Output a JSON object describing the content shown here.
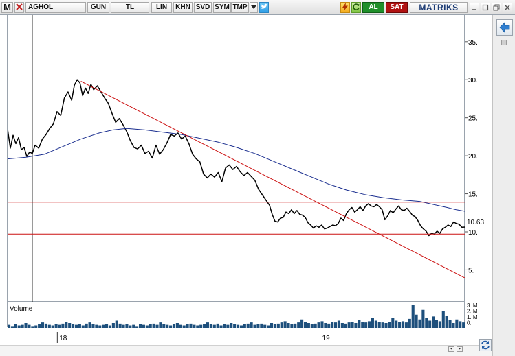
{
  "toolbar": {
    "logo_label": "M",
    "symbol": "AGHOL",
    "period": "GUN",
    "currency": "TL",
    "scale": "LIN",
    "btn_khn": "KHN",
    "btn_svd": "SVD",
    "btn_sym": "SYM",
    "btn_tmp": "TMP",
    "buy_label": "AL",
    "sell_label": "SAT",
    "brand": "MATRIKS",
    "icons": [
      "close-icon",
      "dropdown-icon",
      "twitter-icon",
      "flash-icon",
      "refresh-icon"
    ],
    "window_icons": [
      "minimize-icon",
      "maximize-icon",
      "restore-icon",
      "close-icon"
    ]
  },
  "colors": {
    "price_line": "#000000",
    "moving_average": "#1a2e8f",
    "trend_lines": "#cc1111",
    "volume_bars": "#1d4f7c",
    "buy": "#1f8f2a",
    "sell": "#b01212"
  },
  "chart_data": {
    "type": "line",
    "title": "AGHOL",
    "xlabel": "",
    "ylabel": "",
    "ylim": [
      0.8,
      38.5
    ],
    "yticks": [
      5,
      10,
      15,
      20,
      25,
      30,
      35
    ],
    "ytick_labels": [
      "5.",
      "10.",
      "15.",
      "20.",
      "25.",
      "30.",
      "35."
    ],
    "x_axis_labels": [
      {
        "label": "18",
        "t": 0.11
      },
      {
        "label": "19",
        "t": 0.684
      }
    ],
    "last_price": 10.63,
    "last_price_label": "10.63",
    "grid": false,
    "series": [
      {
        "kind": "price",
        "points": [
          [
            0.0,
            23.5
          ],
          [
            0.006,
            21.0
          ],
          [
            0.012,
            22.7
          ],
          [
            0.018,
            21.6
          ],
          [
            0.024,
            22.4
          ],
          [
            0.03,
            20.8
          ],
          [
            0.036,
            21.1
          ],
          [
            0.042,
            19.9
          ],
          [
            0.048,
            20.5
          ],
          [
            0.054,
            20.3
          ],
          [
            0.06,
            21.4
          ],
          [
            0.068,
            21.0
          ],
          [
            0.076,
            22.2
          ],
          [
            0.084,
            22.8
          ],
          [
            0.092,
            23.6
          ],
          [
            0.1,
            24.2
          ],
          [
            0.108,
            25.8
          ],
          [
            0.116,
            25.3
          ],
          [
            0.124,
            27.6
          ],
          [
            0.132,
            28.4
          ],
          [
            0.14,
            27.3
          ],
          [
            0.146,
            29.3
          ],
          [
            0.152,
            30.0
          ],
          [
            0.158,
            29.6
          ],
          [
            0.164,
            27.9
          ],
          [
            0.17,
            28.9
          ],
          [
            0.176,
            28.2
          ],
          [
            0.182,
            29.4
          ],
          [
            0.188,
            28.7
          ],
          [
            0.196,
            29.2
          ],
          [
            0.204,
            28.4
          ],
          [
            0.212,
            27.6
          ],
          [
            0.22,
            26.9
          ],
          [
            0.228,
            25.6
          ],
          [
            0.236,
            24.4
          ],
          [
            0.244,
            24.9
          ],
          [
            0.252,
            24.1
          ],
          [
            0.26,
            23.2
          ],
          [
            0.268,
            22.0
          ],
          [
            0.276,
            21.1
          ],
          [
            0.284,
            20.9
          ],
          [
            0.292,
            21.4
          ],
          [
            0.3,
            20.3
          ],
          [
            0.308,
            20.6
          ],
          [
            0.316,
            19.7
          ],
          [
            0.324,
            21.4
          ],
          [
            0.332,
            20.2
          ],
          [
            0.34,
            20.8
          ],
          [
            0.348,
            21.7
          ],
          [
            0.356,
            22.8
          ],
          [
            0.364,
            22.6
          ],
          [
            0.372,
            23.0
          ],
          [
            0.38,
            22.2
          ],
          [
            0.388,
            22.6
          ],
          [
            0.396,
            21.6
          ],
          [
            0.404,
            20.2
          ],
          [
            0.412,
            19.6
          ],
          [
            0.42,
            19.2
          ],
          [
            0.428,
            17.6
          ],
          [
            0.436,
            17.1
          ],
          [
            0.444,
            17.6
          ],
          [
            0.452,
            17.2
          ],
          [
            0.46,
            17.8
          ],
          [
            0.468,
            16.6
          ],
          [
            0.476,
            18.4
          ],
          [
            0.484,
            18.8
          ],
          [
            0.492,
            18.2
          ],
          [
            0.5,
            18.6
          ],
          [
            0.508,
            17.9
          ],
          [
            0.516,
            17.4
          ],
          [
            0.524,
            17.8
          ],
          [
            0.532,
            17.3
          ],
          [
            0.54,
            16.8
          ],
          [
            0.548,
            15.6
          ],
          [
            0.556,
            14.9
          ],
          [
            0.564,
            14.2
          ],
          [
            0.572,
            13.5
          ],
          [
            0.578,
            12.3
          ],
          [
            0.584,
            11.4
          ],
          [
            0.59,
            11.3
          ],
          [
            0.596,
            11.8
          ],
          [
            0.602,
            11.9
          ],
          [
            0.608,
            12.6
          ],
          [
            0.614,
            12.4
          ],
          [
            0.62,
            12.9
          ],
          [
            0.626,
            12.4
          ],
          [
            0.632,
            12.8
          ],
          [
            0.638,
            12.3
          ],
          [
            0.644,
            12.2
          ],
          [
            0.65,
            11.9
          ],
          [
            0.656,
            11.2
          ],
          [
            0.662,
            10.9
          ],
          [
            0.668,
            10.5
          ],
          [
            0.674,
            10.8
          ],
          [
            0.68,
            10.6
          ],
          [
            0.686,
            10.9
          ],
          [
            0.692,
            10.4
          ],
          [
            0.698,
            10.5
          ],
          [
            0.704,
            10.7
          ],
          [
            0.71,
            10.9
          ],
          [
            0.716,
            10.8
          ],
          [
            0.722,
            11.1
          ],
          [
            0.728,
            11.8
          ],
          [
            0.734,
            11.5
          ],
          [
            0.74,
            12.4
          ],
          [
            0.746,
            12.9
          ],
          [
            0.752,
            13.2
          ],
          [
            0.758,
            12.6
          ],
          [
            0.764,
            12.9
          ],
          [
            0.77,
            13.3
          ],
          [
            0.776,
            12.8
          ],
          [
            0.782,
            13.4
          ],
          [
            0.788,
            13.7
          ],
          [
            0.794,
            13.4
          ],
          [
            0.8,
            13.3
          ],
          [
            0.806,
            13.6
          ],
          [
            0.812,
            13.3
          ],
          [
            0.818,
            12.9
          ],
          [
            0.824,
            11.6
          ],
          [
            0.83,
            12.1
          ],
          [
            0.836,
            12.8
          ],
          [
            0.842,
            12.5
          ],
          [
            0.848,
            13.0
          ],
          [
            0.854,
            13.4
          ],
          [
            0.86,
            12.9
          ],
          [
            0.866,
            12.8
          ],
          [
            0.872,
            13.1
          ],
          [
            0.878,
            12.7
          ],
          [
            0.884,
            12.2
          ],
          [
            0.89,
            12.0
          ],
          [
            0.896,
            11.5
          ],
          [
            0.902,
            10.8
          ],
          [
            0.908,
            10.4
          ],
          [
            0.914,
            10.1
          ],
          [
            0.92,
            9.5
          ],
          [
            0.926,
            9.8
          ],
          [
            0.932,
            9.7
          ],
          [
            0.938,
            10.1
          ],
          [
            0.944,
            9.8
          ],
          [
            0.95,
            10.4
          ],
          [
            0.956,
            10.6
          ],
          [
            0.962,
            10.9
          ],
          [
            0.968,
            10.7
          ],
          [
            0.974,
            11.3
          ],
          [
            0.98,
            11.1
          ],
          [
            0.986,
            11.0
          ],
          [
            0.992,
            10.6
          ],
          [
            1.0,
            10.63
          ]
        ]
      },
      {
        "kind": "moving-average",
        "points": [
          [
            0.0,
            19.6
          ],
          [
            0.04,
            19.8
          ],
          [
            0.08,
            20.2
          ],
          [
            0.12,
            21.2
          ],
          [
            0.16,
            22.2
          ],
          [
            0.2,
            23.0
          ],
          [
            0.23,
            23.4
          ],
          [
            0.26,
            23.6
          ],
          [
            0.3,
            23.4
          ],
          [
            0.34,
            23.1
          ],
          [
            0.38,
            22.8
          ],
          [
            0.42,
            22.3
          ],
          [
            0.46,
            21.8
          ],
          [
            0.5,
            21.1
          ],
          [
            0.54,
            20.3
          ],
          [
            0.58,
            19.3
          ],
          [
            0.62,
            18.3
          ],
          [
            0.66,
            17.3
          ],
          [
            0.7,
            16.3
          ],
          [
            0.74,
            15.5
          ],
          [
            0.78,
            14.9
          ],
          [
            0.82,
            14.5
          ],
          [
            0.86,
            14.2
          ],
          [
            0.9,
            14.0
          ],
          [
            0.93,
            13.6
          ],
          [
            0.96,
            13.2
          ],
          [
            0.98,
            12.9
          ],
          [
            1.0,
            12.7
          ]
        ]
      },
      {
        "kind": "trend-line",
        "points": [
          [
            0.16,
            29.8
          ],
          [
            1.0,
            3.9
          ]
        ]
      },
      {
        "kind": "horizontal-line",
        "points": [
          [
            0.0,
            13.9
          ],
          [
            1.0,
            13.9
          ]
        ]
      },
      {
        "kind": "horizontal-line",
        "points": [
          [
            0.0,
            9.7
          ],
          [
            1.0,
            9.7
          ]
        ]
      }
    ],
    "volume": {
      "label": "Volume",
      "ytick_labels": [
        "3. M",
        "2. M",
        "1. M",
        "0."
      ],
      "ylim": [
        0,
        4.0
      ],
      "values": [
        0.5,
        0.3,
        0.6,
        0.4,
        0.5,
        0.8,
        0.5,
        0.3,
        0.4,
        0.6,
        0.9,
        0.7,
        0.5,
        0.4,
        0.6,
        0.5,
        0.7,
        1.0,
        0.8,
        0.6,
        0.5,
        0.6,
        0.4,
        0.7,
        0.9,
        0.6,
        0.5,
        0.4,
        0.5,
        0.6,
        0.4,
        0.8,
        1.2,
        0.7,
        0.5,
        0.6,
        0.4,
        0.5,
        0.3,
        0.6,
        0.5,
        0.4,
        0.6,
        0.7,
        0.5,
        0.9,
        0.6,
        0.5,
        0.4,
        0.6,
        0.8,
        0.5,
        0.4,
        0.6,
        0.7,
        0.5,
        0.4,
        0.5,
        0.6,
        0.9,
        0.6,
        0.5,
        0.7,
        0.4,
        0.6,
        0.5,
        0.8,
        0.6,
        0.5,
        0.4,
        0.6,
        0.7,
        0.9,
        0.5,
        0.6,
        0.7,
        0.5,
        0.4,
        0.8,
        0.6,
        0.7,
        0.9,
        1.1,
        0.8,
        0.6,
        0.7,
        0.9,
        1.4,
        1.0,
        0.8,
        0.6,
        0.7,
        0.9,
        1.1,
        0.8,
        0.7,
        1.0,
        0.9,
        1.2,
        0.8,
        0.7,
        0.9,
        1.0,
        0.8,
        1.3,
        1.0,
        0.9,
        1.1,
        1.6,
        1.2,
        1.0,
        0.9,
        0.8,
        1.0,
        1.7,
        1.2,
        1.0,
        1.1,
        0.9,
        1.5,
        3.8,
        2.2,
        1.4,
        3.0,
        1.6,
        1.2,
        1.9,
        1.3,
        1.1,
        2.8,
        2.0,
        1.3,
        0.8,
        1.4,
        1.1,
        0.9
      ]
    }
  }
}
